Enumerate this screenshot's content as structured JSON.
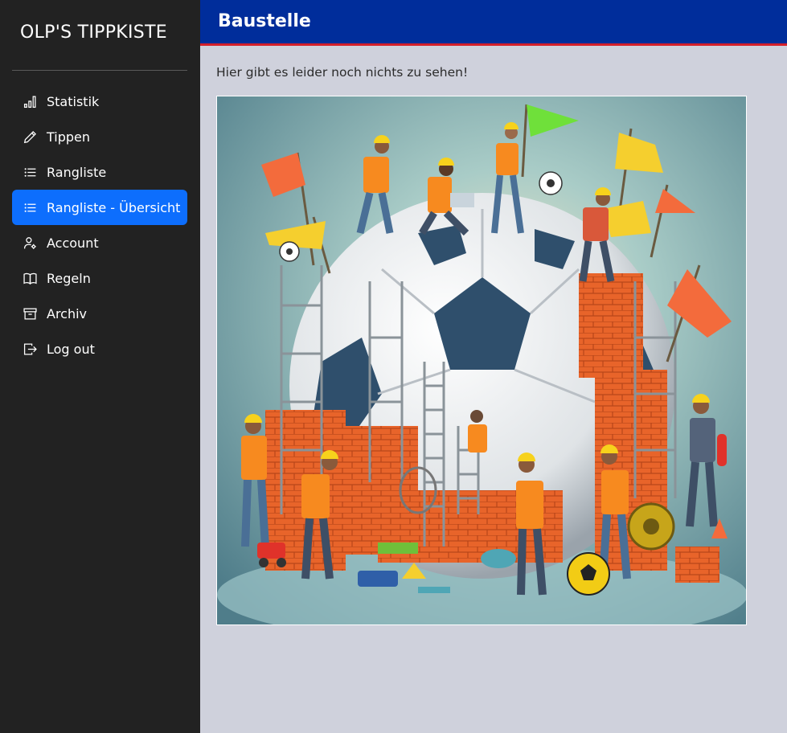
{
  "sidebar": {
    "brand": "OLP'S TIPPKISTE",
    "items": [
      {
        "label": "Statistik",
        "icon": "bar-chart-icon",
        "active": false
      },
      {
        "label": "Tippen",
        "icon": "pencil-icon",
        "active": false
      },
      {
        "label": "Rangliste",
        "icon": "list-icon",
        "active": false
      },
      {
        "label": "Rangliste - Übersicht",
        "icon": "list-icon",
        "active": true
      },
      {
        "label": "Account",
        "icon": "user-gear-icon",
        "active": false
      },
      {
        "label": "Regeln",
        "icon": "book-icon",
        "active": false
      },
      {
        "label": "Archiv",
        "icon": "archive-icon",
        "active": false
      },
      {
        "label": "Log out",
        "icon": "logout-icon",
        "active": false
      }
    ]
  },
  "header": {
    "title": "Baustelle"
  },
  "main": {
    "notice": "Hier gibt es leider noch nichts zu sehen!",
    "image": {
      "subject": "construction-illustration"
    }
  },
  "colors": {
    "sidebar_bg": "#222222",
    "active_item": "#0d6efd",
    "header_bg": "#002d9b",
    "header_accent": "#d4202b",
    "page_bg": "#cfd1dc"
  }
}
